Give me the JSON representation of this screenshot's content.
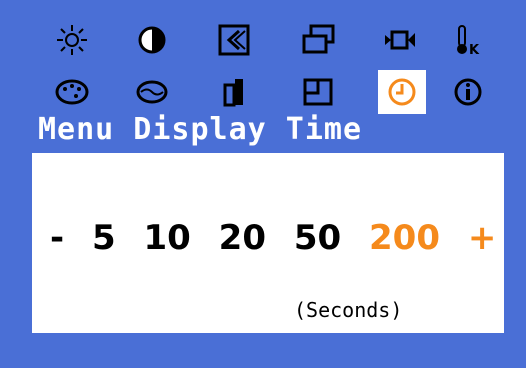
{
  "osd": {
    "background_color": "#4a6fd6",
    "accent_color": "#f58a1c",
    "menu_title": "Menu Display Time",
    "icons_row1": [
      "brightness-icon",
      "contrast-icon",
      "position-icon",
      "size-icon",
      "video-icon",
      "color-temperature-icon"
    ],
    "icons_row2": [
      "color-palette-icon",
      "moire-icon",
      "geometry-icon",
      "window-icon",
      "clock-icon",
      "information-icon"
    ],
    "selected_icon": "clock-icon",
    "options": {
      "minus": "-",
      "values": [
        "5",
        "10",
        "20",
        "50",
        "200"
      ],
      "plus": "+",
      "selected_value": "200"
    },
    "units_label": "(Seconds)"
  }
}
